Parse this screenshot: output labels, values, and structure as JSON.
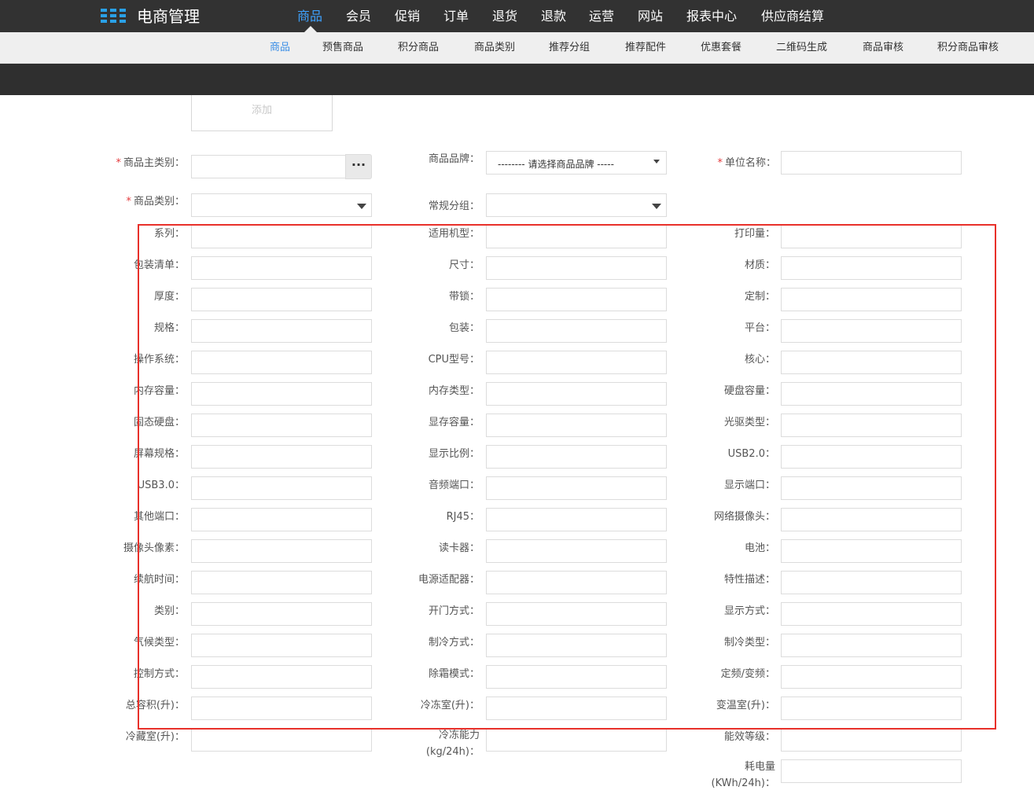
{
  "app": {
    "title": "电商管理"
  },
  "main_nav": [
    {
      "label": "商品",
      "active": true
    },
    {
      "label": "会员"
    },
    {
      "label": "促销"
    },
    {
      "label": "订单"
    },
    {
      "label": "退货"
    },
    {
      "label": "退款"
    },
    {
      "label": "运营"
    },
    {
      "label": "网站"
    },
    {
      "label": "报表中心"
    },
    {
      "label": "供应商结算"
    }
  ],
  "sub_nav": [
    {
      "label": "商品",
      "active": true
    },
    {
      "label": "预售商品"
    },
    {
      "label": "积分商品"
    },
    {
      "label": "商品类别"
    },
    {
      "label": "推荐分组"
    },
    {
      "label": "推荐配件"
    },
    {
      "label": "优惠套餐"
    },
    {
      "label": "二维码生成"
    },
    {
      "label": "商品审核"
    },
    {
      "label": "积分商品审核"
    }
  ],
  "add_button": {
    "label": "添加"
  },
  "top_fields": {
    "main_category": {
      "required_mark": "*",
      "label": "商品主类别：",
      "value": "",
      "picker_label": "···"
    },
    "brand": {
      "label": "商品品牌：",
      "value": "-------- 请选择商品品牌 -----"
    },
    "unit_name": {
      "required_mark": "*",
      "label": "单位名称：",
      "value": ""
    },
    "category": {
      "required_mark": "*",
      "label": "商品类别：",
      "value": ""
    },
    "group": {
      "label": "常规分组：",
      "value": ""
    }
  },
  "attribute_rows": [
    [
      "系列：",
      "适用机型：",
      "打印量："
    ],
    [
      "包装清单：",
      "尺寸：",
      "材质："
    ],
    [
      "厚度：",
      "带锁：",
      "定制："
    ],
    [
      "规格：",
      "包装：",
      "平台："
    ],
    [
      "操作系统：",
      "CPU型号：",
      "核心："
    ],
    [
      "内存容量：",
      "内存类型：",
      "硬盘容量："
    ],
    [
      "固态硬盘：",
      "显存容量：",
      "光驱类型："
    ],
    [
      "屏幕规格：",
      "显示比例：",
      "USB2.0："
    ],
    [
      "USB3.0：",
      "音频端口：",
      "显示端口："
    ],
    [
      "其他端口：",
      "RJ45：",
      "网络摄像头："
    ],
    [
      "摄像头像素：",
      "读卡器：",
      "电池："
    ],
    [
      "续航时间：",
      "电源适配器：",
      "特性描述："
    ],
    [
      "类别：",
      "开门方式：",
      "显示方式："
    ],
    [
      "气候类型：",
      "制冷方式：",
      "制冷类型："
    ],
    [
      "控制方式：",
      "除霜模式：",
      "定频/变频："
    ],
    [
      "总容积(升)：",
      "冷冻室(升)：",
      "变温室(升)："
    ],
    [
      "冷藏室(升)：",
      "冷冻能力(kg/24h)：",
      "能效等级："
    ],
    [
      "",
      "",
      "耗电量(KWh/24h)："
    ]
  ],
  "colors": {
    "topbar": "#323232",
    "accent": "#3ea2ff",
    "subnav_bg": "#efefef",
    "darkbar": "#2f2f2f",
    "required": "#e4393c",
    "highlight": "#e8302a"
  }
}
